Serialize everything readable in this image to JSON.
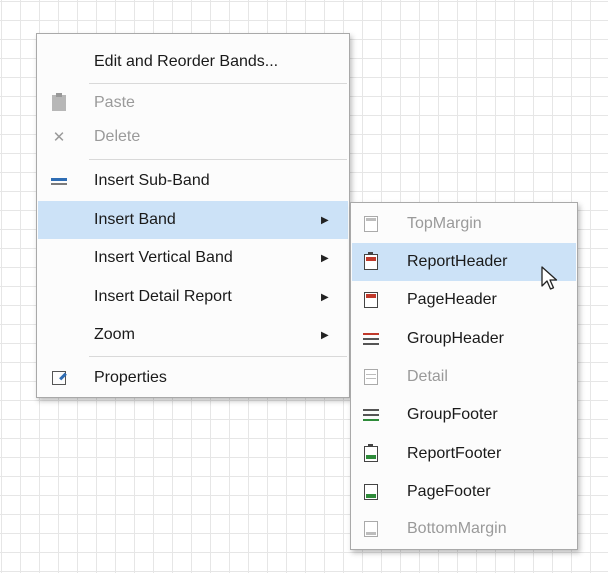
{
  "context_menu": {
    "items": [
      {
        "label": "Edit and Reorder Bands...",
        "icon": "none"
      },
      {
        "label": "Paste",
        "icon": "paste-icon",
        "disabled": true
      },
      {
        "label": "Delete",
        "icon": "delete-icon",
        "disabled": true
      },
      {
        "label": "Insert Sub-Band",
        "icon": "sub-band-icon"
      },
      {
        "label": "Insert Band",
        "icon": "none",
        "has_submenu": true,
        "highlighted": true
      },
      {
        "label": "Insert Vertical Band",
        "icon": "none",
        "has_submenu": true
      },
      {
        "label": "Insert Detail Report",
        "icon": "none",
        "has_submenu": true
      },
      {
        "label": "Zoom",
        "icon": "none",
        "has_submenu": true
      },
      {
        "label": "Properties",
        "icon": "properties-icon"
      }
    ],
    "arrow_glyph": "▶",
    "delete_glyph": "✕"
  },
  "submenu": {
    "items": [
      {
        "label": "TopMargin",
        "icon": "top-margin-icon",
        "disabled": true
      },
      {
        "label": "ReportHeader",
        "icon": "report-header-icon",
        "highlighted": true
      },
      {
        "label": "PageHeader",
        "icon": "page-header-icon"
      },
      {
        "label": "GroupHeader",
        "icon": "group-header-icon"
      },
      {
        "label": "Detail",
        "icon": "detail-icon",
        "disabled": true
      },
      {
        "label": "GroupFooter",
        "icon": "group-footer-icon"
      },
      {
        "label": "ReportFooter",
        "icon": "report-footer-icon"
      },
      {
        "label": "PageFooter",
        "icon": "page-footer-icon"
      },
      {
        "label": "BottomMargin",
        "icon": "bottom-margin-icon",
        "disabled": true
      }
    ]
  },
  "colors": {
    "highlight": "#cce2f7",
    "accent_red": "#c0392b",
    "accent_green": "#2e8b3a",
    "accent_blue": "#2e6db4",
    "grid": "#e6e6e6"
  }
}
